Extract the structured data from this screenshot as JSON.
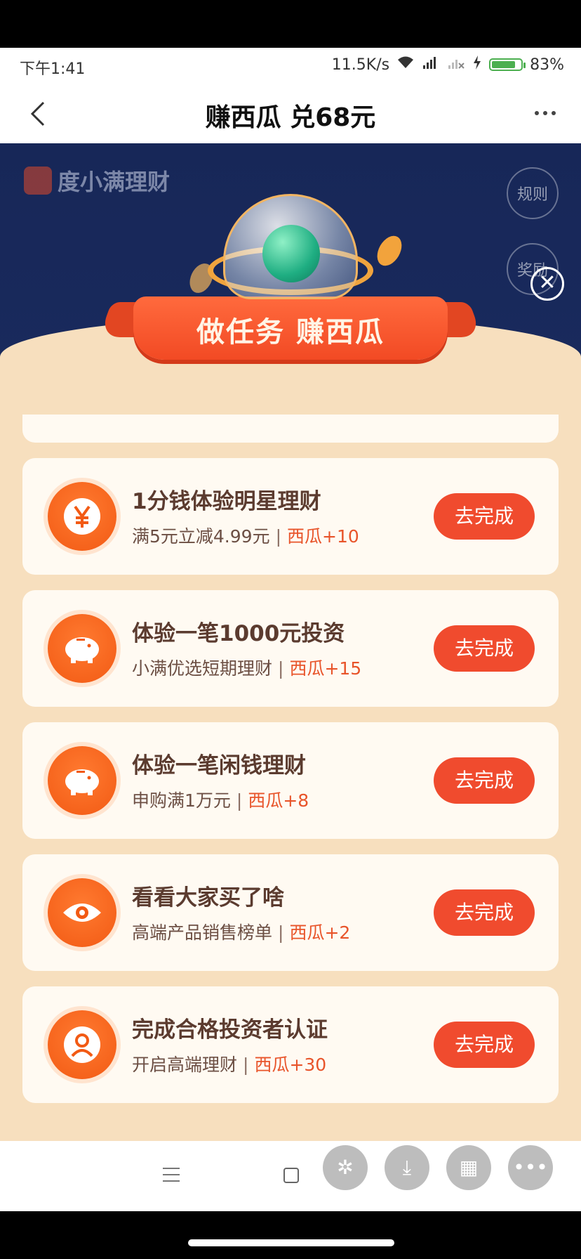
{
  "status_bar": {
    "time": "下午1:41",
    "network_speed": "11.5K/s",
    "battery_percent": "83%",
    "battery_level": 0.83
  },
  "nav": {
    "title": "赚西瓜 兑68元"
  },
  "background": {
    "brand_name": "度小满理财",
    "rules_label": "规则",
    "reward_label": "奖励"
  },
  "panel": {
    "banner_title": "做任务 赚西瓜",
    "tasks": [
      {
        "icon": "yuan-icon",
        "title": "1分钱体验明星理财",
        "desc": "满5元立减4.99元",
        "reward": "西瓜+10",
        "button": "去完成"
      },
      {
        "icon": "piggy-bank-icon",
        "title": "体验一笔1000元投资",
        "desc": "小满优选短期理财",
        "reward": "西瓜+15",
        "button": "去完成"
      },
      {
        "icon": "piggy-bank-icon",
        "title": "体验一笔闲钱理财",
        "desc": "申购满1万元",
        "reward": "西瓜+8",
        "button": "去完成"
      },
      {
        "icon": "eye-icon",
        "title": "看看大家买了啥",
        "desc": "高端产品销售榜单",
        "reward": "西瓜+2",
        "button": "去完成"
      },
      {
        "icon": "user-icon",
        "title": "完成合格投资者认证",
        "desc": "开启高端理财",
        "reward": "西瓜+30",
        "button": "去完成"
      }
    ]
  },
  "colors": {
    "accent": "#f04b2e",
    "panel_bg": "#f7dfbe",
    "card_bg": "#fffaf2",
    "header_bg": "#172758"
  }
}
